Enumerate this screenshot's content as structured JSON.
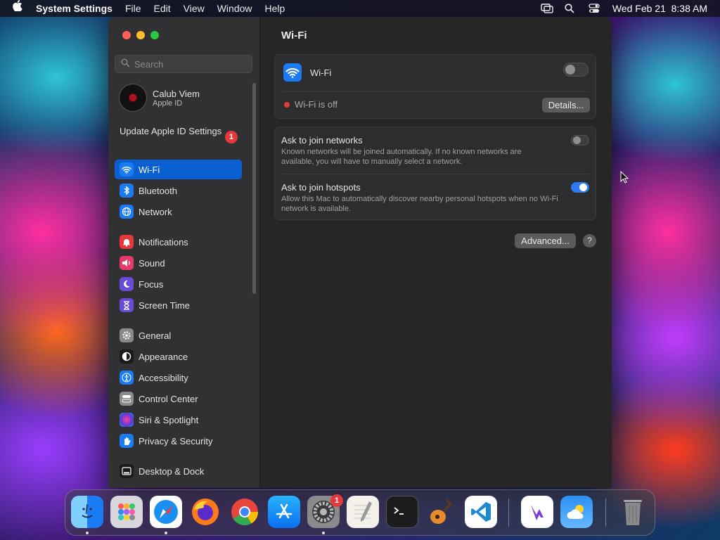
{
  "menubar": {
    "app_name": "System Settings",
    "items": [
      "File",
      "Edit",
      "View",
      "Window",
      "Help"
    ],
    "clock": "Wed Feb 21  8:38 AM"
  },
  "sidebar": {
    "search_placeholder": "Search",
    "account": {
      "name": "Calub Viem",
      "subtitle": "Apple ID"
    },
    "update": {
      "label": "Update Apple ID Settings",
      "badge": "1"
    },
    "items": [
      {
        "label": "Wi-Fi",
        "icon": "wifi-icon",
        "color": "#1a7bf2",
        "active": true
      },
      {
        "label": "Bluetooth",
        "icon": "bluetooth-icon",
        "color": "#1a7bf2"
      },
      {
        "label": "Network",
        "icon": "globe-icon",
        "color": "#1a7bf2"
      },
      {
        "label": "Notifications",
        "icon": "bell-icon",
        "color": "#e5383b"
      },
      {
        "label": "Sound",
        "icon": "speaker-icon",
        "color": "#e5386b"
      },
      {
        "label": "Focus",
        "icon": "moon-icon",
        "color": "#6a4bd6"
      },
      {
        "label": "Screen Time",
        "icon": "hourglass-icon",
        "color": "#6a4bd6"
      },
      {
        "label": "General",
        "icon": "gear-icon",
        "color": "#8a8a8d"
      },
      {
        "label": "Appearance",
        "icon": "contrast-icon",
        "color": "#1a1a1a"
      },
      {
        "label": "Accessibility",
        "icon": "accessibility-icon",
        "color": "#1a7bf2"
      },
      {
        "label": "Control Center",
        "icon": "switches-icon",
        "color": "#8a8a8d"
      },
      {
        "label": "Siri & Spotlight",
        "icon": "siri-icon",
        "color": "#a43cd6"
      },
      {
        "label": "Privacy & Security",
        "icon": "hand-icon",
        "color": "#1a7bf2"
      },
      {
        "label": "Desktop & Dock",
        "icon": "dock-icon",
        "color": "#1a1a1a"
      }
    ]
  },
  "content": {
    "title": "Wi-Fi",
    "wifi_label": "Wi-Fi",
    "wifi_on": false,
    "status": "Wi-Fi is off",
    "details_button": "Details...",
    "ask_networks": {
      "title": "Ask to join networks",
      "desc": "Known networks will be joined automatically. If no known networks are available, you will have to manually select a network.",
      "on": false
    },
    "ask_hotspots": {
      "title": "Ask to join hotspots",
      "desc": "Allow this Mac to automatically discover nearby personal hotspots when no Wi-Fi network is available.",
      "on": true
    },
    "advanced_button": "Advanced...",
    "help_button": "?"
  },
  "dock": {
    "system_settings_badge": "1",
    "apps": [
      "Finder",
      "Launchpad",
      "Safari",
      "Firefox",
      "Chrome",
      "App Store",
      "System Settings",
      "TextEdit",
      "Terminal",
      "GarageBand",
      "VS Code",
      "Visual Studio",
      "Weather",
      "Trash"
    ]
  }
}
